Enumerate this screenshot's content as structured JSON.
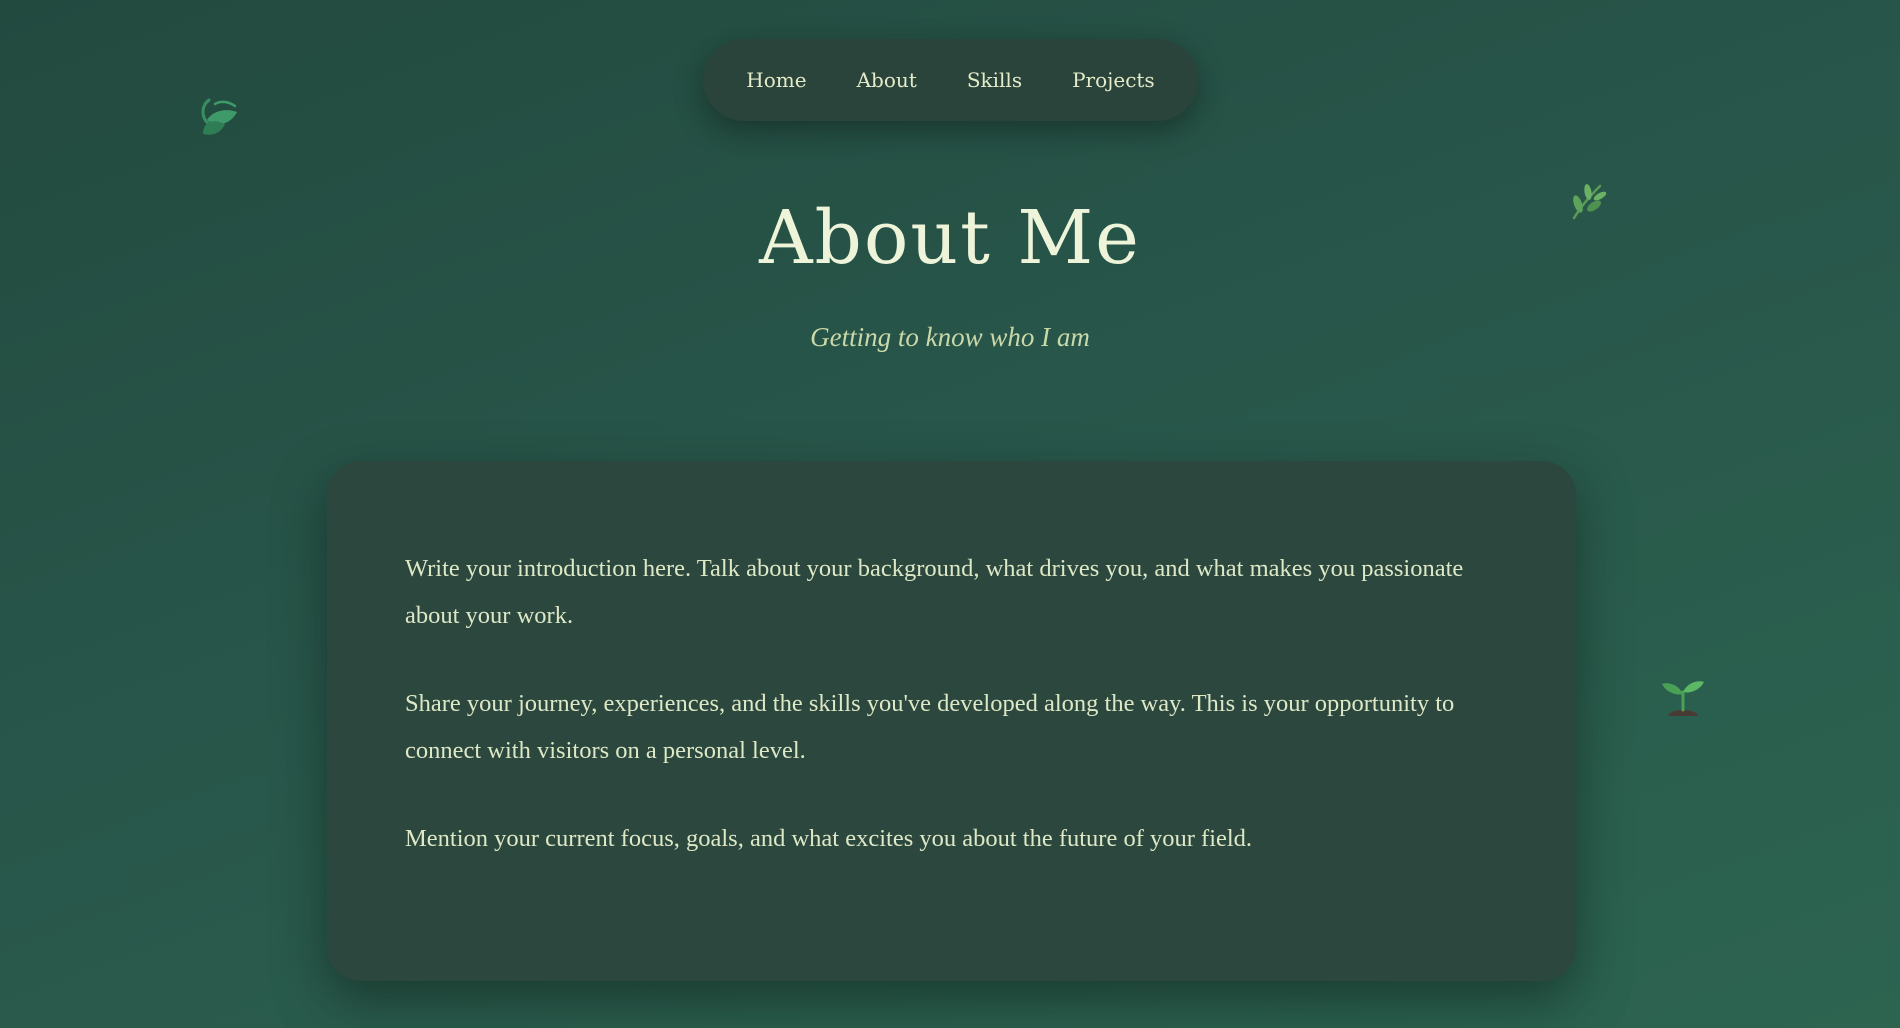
{
  "nav": {
    "items": [
      {
        "label": "Home"
      },
      {
        "label": "About"
      },
      {
        "label": "Skills"
      },
      {
        "label": "Projects"
      }
    ]
  },
  "header": {
    "title": "About Me",
    "subtitle": "Getting to know who I am"
  },
  "about": {
    "paragraphs": [
      "Write your introduction here. Talk about your background, what drives you, and what makes you passionate about your work.",
      "Share your journey, experiences, and the skills you've developed along the way. This is your opportunity to connect with visitors on a personal level.",
      "Mention your current focus, goals, and what excites you about the future of your field."
    ]
  },
  "decorations": [
    {
      "icon": "leaf-icon"
    },
    {
      "icon": "herb-icon"
    },
    {
      "icon": "seedling-icon"
    }
  ],
  "colors": {
    "background": "#28564a",
    "nav_bg": "#2b443b",
    "card_bg": "#2c473e",
    "title": "#eef4d9",
    "subtitle": "#c9d8a8",
    "body_text": "#dde8c6",
    "leaf_accent": "#3f9a6a"
  }
}
